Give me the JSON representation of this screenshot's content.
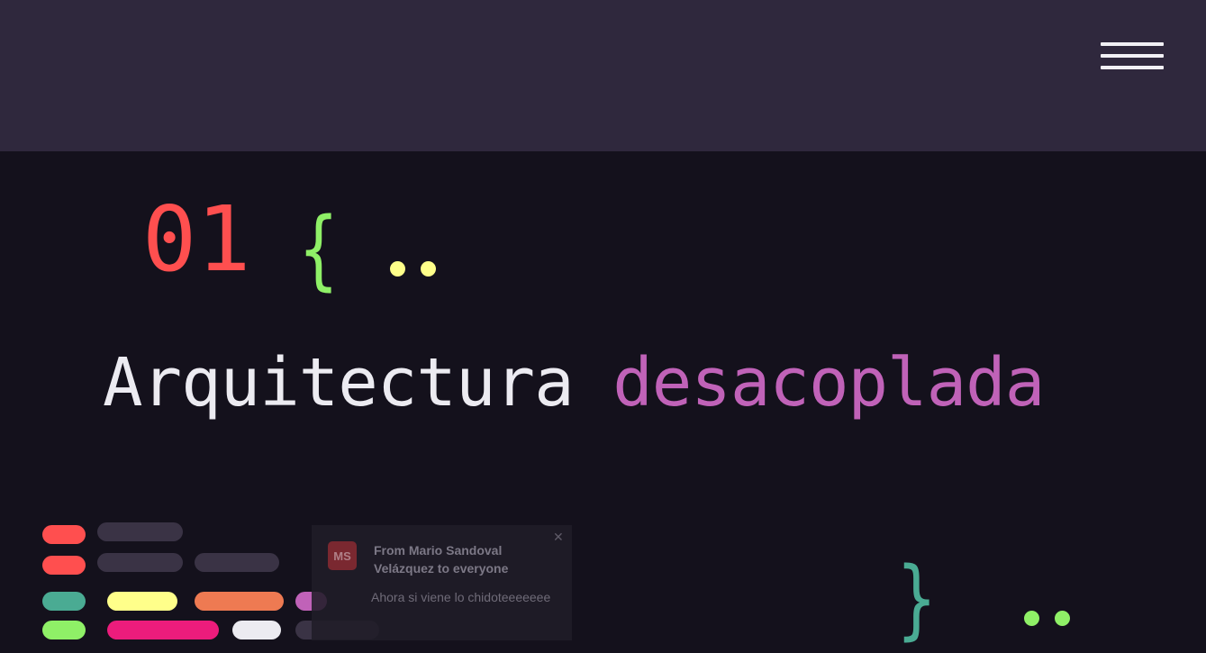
{
  "header": {
    "menu_icon": "hamburger-menu-icon"
  },
  "slide": {
    "number": "01",
    "brace_open": "{",
    "brace_close": "}",
    "title_word_1": "Arquitectura",
    "title_word_2": "desacoplada"
  },
  "colors": {
    "header_bg": "#2f283d",
    "page_bg": "#14111c",
    "number": "#ff4f4f",
    "brace_open": "#8ff067",
    "brace_close": "#4aab93",
    "dots_top": "#ffff8a",
    "dots_bottom": "#8ff067",
    "title_primary": "#ecebf1",
    "title_accent": "#c062b8"
  },
  "code_decoration": {
    "pill_colors": [
      "#ff4f4f",
      "#3a3345",
      "#8ff067",
      "#ffff8a",
      "#ee7a52",
      "#c062b8",
      "#4aab93",
      "#ec1c7c",
      "#ecebf1"
    ]
  },
  "notification": {
    "avatar_initials": "MS",
    "from": "From Mario Sandoval Velázquez to everyone",
    "message": "Ahora si viene lo chidoteeeeeee",
    "close_icon": "close-icon"
  }
}
